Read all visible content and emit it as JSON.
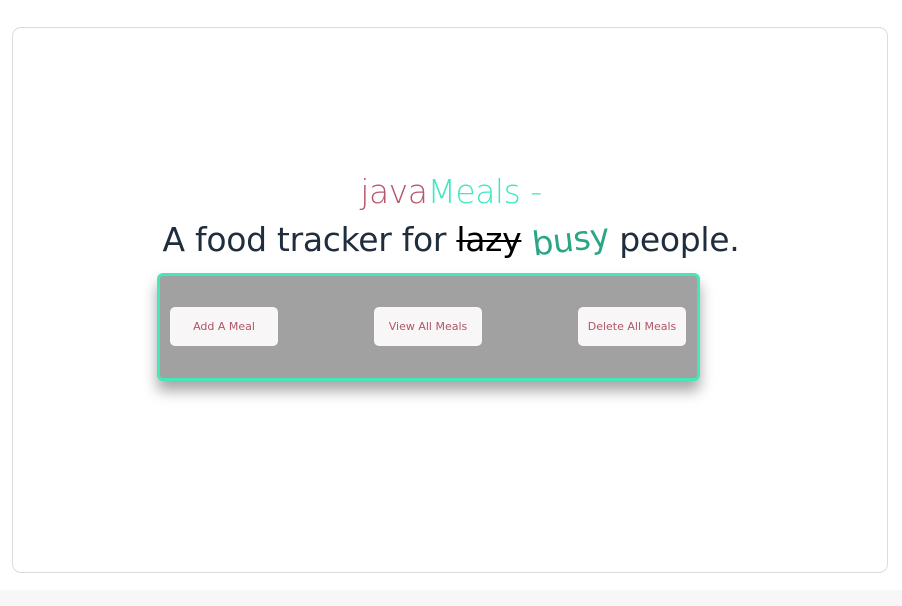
{
  "header": {
    "brand_part1": "java",
    "brand_part2": "Meals",
    "brand_suffix": " -",
    "tagline_prefix": "A food tracker for ",
    "tagline_struck": "lazy",
    "tagline_replacement": "busy",
    "tagline_suffix": " people."
  },
  "actions": {
    "add_label": "Add A Meal",
    "view_label": "View All Meals",
    "delete_label": "Delete All Meals"
  },
  "colors": {
    "brand_java": "#b9566a",
    "brand_meals": "#3ee8c2",
    "panel_bg": "#a1a1a1",
    "panel_border": "#45e6b8",
    "button_text": "#b05666"
  }
}
